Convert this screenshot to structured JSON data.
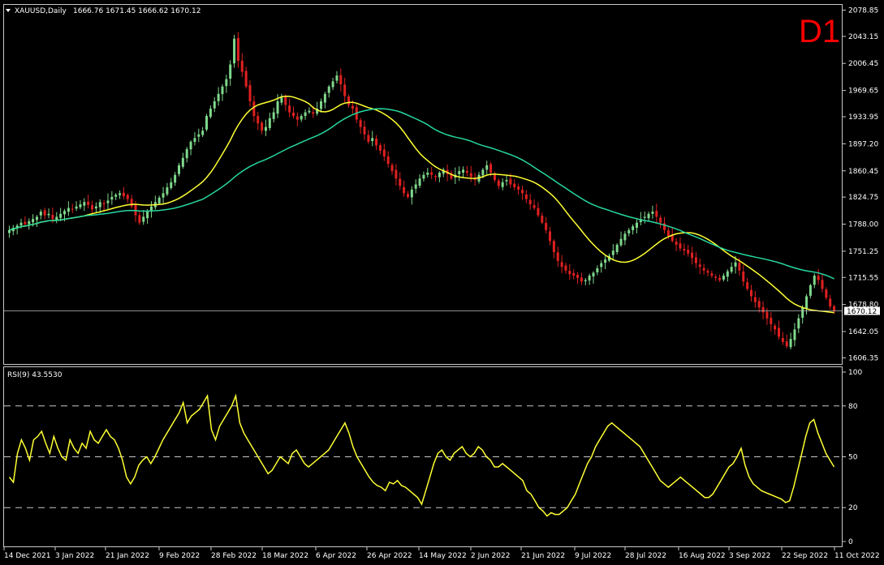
{
  "header": {
    "symbol": "XAUUSD,Daily",
    "ohlc": "1666.76 1671.45 1666.62 1670.12",
    "timeframe": "D1"
  },
  "rsi": {
    "label": "RSI(9) 43.5530"
  },
  "colors": {
    "background": "#000000",
    "bull": "#7fd88c",
    "bear": "#e02020",
    "ma_fast": "#ffff33",
    "ma_slow": "#26d6a0",
    "rsi_line": "#ffff33",
    "grid": "#c8c8c8",
    "axis_text": "#ffffff",
    "timeframe_label": "#ff0000"
  },
  "chart_data": [
    {
      "type": "candlestick",
      "title": "XAUUSD,Daily",
      "y_ticks": [
        "2078.85",
        "2043.15",
        "2006.45",
        "1969.65",
        "1933.95",
        "1897.20",
        "1860.45",
        "1824.75",
        "1788.00",
        "1751.25",
        "1715.55",
        "1678.80",
        "1642.05",
        "1606.35"
      ],
      "ylim": [
        1598,
        2086
      ],
      "current_price": "1670.12",
      "x_ticks": [
        "14 Dec 2021",
        "3 Jan 2022",
        "21 Jan 2022",
        "9 Feb 2022",
        "28 Feb 2022",
        "18 Mar 2022",
        "6 Apr 2022",
        "26 Apr 2022",
        "14 May 2022",
        "2 Jun 2022",
        "21 Jun 2022",
        "9 Jul 2022",
        "28 Jul 2022",
        "16 Aug 2022",
        "3 Sep 2022",
        "22 Sep 2022",
        "11 Oct 2022"
      ],
      "close_path": [
        1780,
        1783,
        1786,
        1790,
        1788,
        1792,
        1795,
        1798,
        1805,
        1800,
        1802,
        1795,
        1798,
        1802,
        1806,
        1810,
        1808,
        1812,
        1815,
        1818,
        1814,
        1808,
        1812,
        1818,
        1815,
        1820,
        1825,
        1828,
        1830,
        1826,
        1822,
        1812,
        1800,
        1790,
        1798,
        1805,
        1812,
        1818,
        1824,
        1830,
        1838,
        1845,
        1855,
        1868,
        1878,
        1890,
        1900,
        1905,
        1910,
        1915,
        1935,
        1945,
        1955,
        1965,
        1975,
        1985,
        2005,
        2040,
        2010,
        1995,
        1975,
        1955,
        1935,
        1925,
        1915,
        1920,
        1932,
        1940,
        1955,
        1960,
        1950,
        1940,
        1935,
        1930,
        1935,
        1940,
        1942,
        1938,
        1945,
        1955,
        1965,
        1975,
        1982,
        1990,
        1978,
        1962,
        1950,
        1945,
        1930,
        1920,
        1910,
        1900,
        1905,
        1895,
        1888,
        1880,
        1870,
        1860,
        1850,
        1840,
        1830,
        1825,
        1835,
        1842,
        1850,
        1855,
        1858,
        1855,
        1852,
        1858,
        1862,
        1856,
        1850,
        1855,
        1860,
        1862,
        1858,
        1852,
        1848,
        1855,
        1862,
        1868,
        1858,
        1848,
        1840,
        1845,
        1848,
        1842,
        1838,
        1835,
        1830,
        1822,
        1815,
        1810,
        1800,
        1790,
        1780,
        1765,
        1750,
        1738,
        1730,
        1725,
        1720,
        1718,
        1715,
        1710,
        1712,
        1718,
        1722,
        1728,
        1735,
        1740,
        1745,
        1752,
        1760,
        1768,
        1775,
        1780,
        1785,
        1790,
        1795,
        1798,
        1802,
        1805,
        1798,
        1790,
        1780,
        1772,
        1765,
        1760,
        1755,
        1752,
        1748,
        1742,
        1735,
        1730,
        1725,
        1722,
        1718,
        1715,
        1712,
        1718,
        1724,
        1730,
        1736,
        1725,
        1710,
        1700,
        1690,
        1682,
        1675,
        1668,
        1660,
        1652,
        1645,
        1635,
        1628,
        1622,
        1632,
        1645,
        1660,
        1675,
        1690,
        1705,
        1718,
        1712,
        1700,
        1688,
        1676,
        1670
      ],
      "series": [
        {
          "name": "",
          "type": "ma",
          "period": 20,
          "color": "#ffff33"
        },
        {
          "name": "",
          "type": "ma",
          "period": 50,
          "color": "#26d6a0"
        }
      ]
    },
    {
      "type": "line",
      "title": "RSI(9) 43.5530",
      "y_ticks": [
        100,
        80,
        50,
        20,
        0
      ],
      "levels": [
        80,
        50,
        20
      ],
      "ylim": [
        0,
        100
      ],
      "values": [
        38,
        35,
        52,
        60,
        55,
        48,
        60,
        62,
        65,
        58,
        52,
        62,
        55,
        50,
        48,
        60,
        55,
        52,
        58,
        55,
        65,
        60,
        58,
        62,
        66,
        62,
        60,
        55,
        48,
        38,
        34,
        38,
        45,
        48,
        50,
        46,
        50,
        55,
        60,
        64,
        68,
        72,
        76,
        82,
        70,
        74,
        76,
        78,
        82,
        86,
        66,
        60,
        68,
        72,
        76,
        80,
        86,
        70,
        64,
        60,
        56,
        52,
        48,
        44,
        40,
        42,
        46,
        50,
        48,
        46,
        52,
        54,
        50,
        46,
        44,
        46,
        48,
        50,
        52,
        54,
        58,
        62,
        66,
        70,
        64,
        56,
        50,
        46,
        42,
        38,
        35,
        33,
        32,
        30,
        35,
        34,
        36,
        33,
        32,
        30,
        28,
        26,
        22,
        30,
        38,
        46,
        52,
        54,
        50,
        48,
        52,
        54,
        56,
        52,
        50,
        52,
        56,
        54,
        50,
        48,
        44,
        44,
        46,
        44,
        42,
        40,
        38,
        36,
        30,
        28,
        24,
        20,
        18,
        15,
        17,
        16,
        16,
        18,
        20,
        24,
        28,
        34,
        40,
        46,
        50,
        56,
        60,
        64,
        68,
        70,
        68,
        66,
        64,
        62,
        60,
        58,
        56,
        52,
        48,
        44,
        40,
        36,
        34,
        32,
        34,
        36,
        38,
        36,
        34,
        32,
        30,
        28,
        26,
        26,
        28,
        32,
        36,
        40,
        44,
        46,
        50,
        55,
        45,
        38,
        34,
        32,
        30,
        29,
        28,
        27,
        26,
        25,
        23,
        24,
        32,
        42,
        52,
        62,
        70,
        72,
        64,
        58,
        52,
        48,
        44
      ]
    }
  ]
}
